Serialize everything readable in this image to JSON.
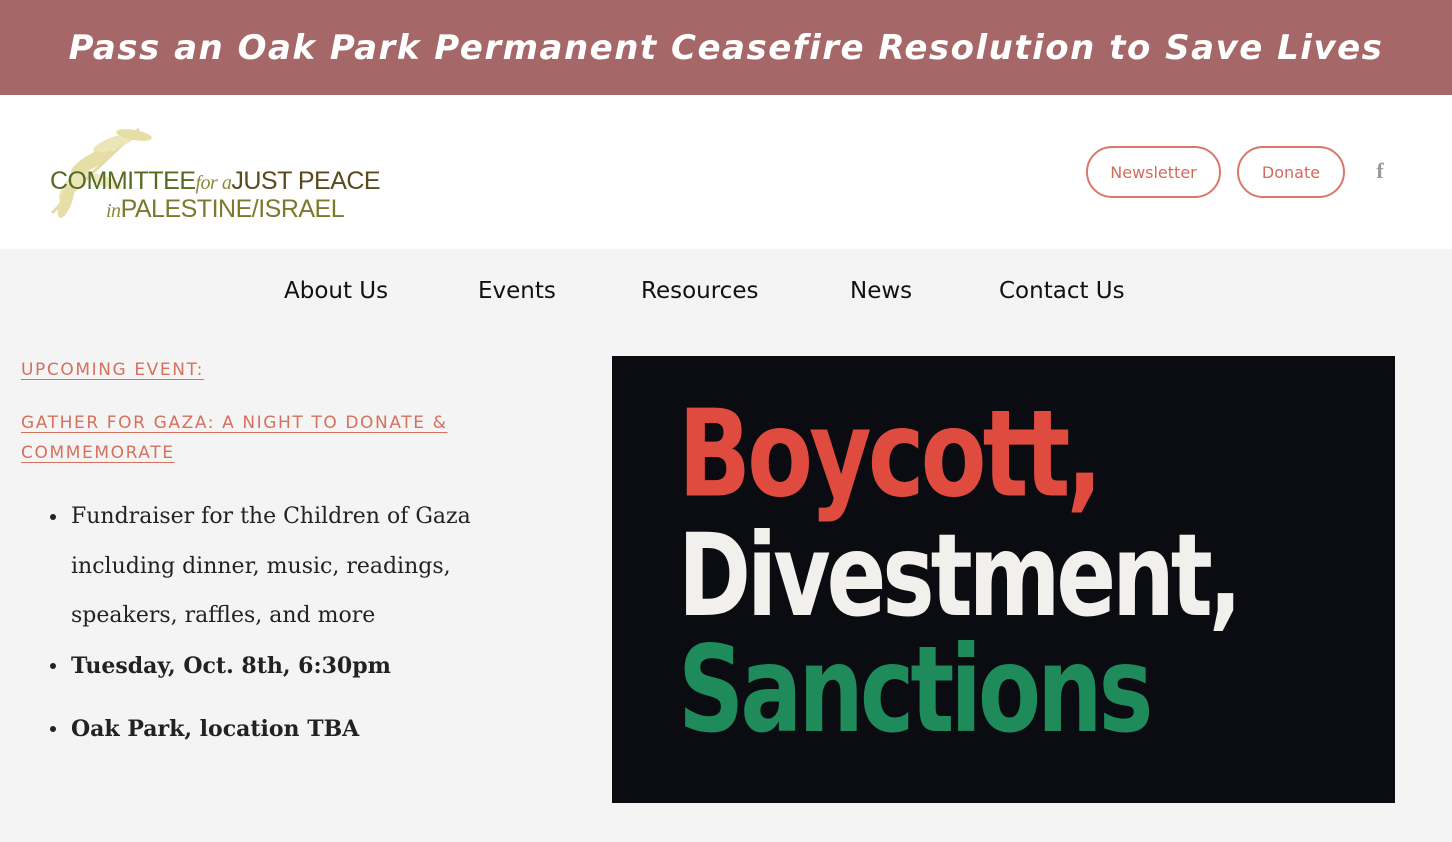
{
  "banner": {
    "text": "Pass an Oak Park Permanent Ceasefire Resolution to Save Lives"
  },
  "logo": {
    "line1_a": "COMMITTEE",
    "line1_b": "for a",
    "line1_c": "JUST PEACE",
    "line2_a": "in",
    "line2_b": "PALESTINE/ISRAEL"
  },
  "header": {
    "newsletter_label": "Newsletter",
    "donate_label": "Donate",
    "facebook_glyph": "f"
  },
  "nav": {
    "items": [
      {
        "label": "About Us"
      },
      {
        "label": "Events"
      },
      {
        "label": "Resources"
      },
      {
        "label": "News"
      },
      {
        "label": "Contact Us"
      }
    ]
  },
  "event": {
    "label": "UPCOMING EVENT:",
    "title": "GATHER FOR GAZA: A NIGHT TO DONATE & COMMEMORATE",
    "bullets": [
      "Fundraiser for the Children of Gaza including dinner, music, readings, speakers, raffles, and more",
      "Tuesday, Oct. 8th, 6:30pm",
      "Oak Park, location TBA"
    ]
  },
  "poster": {
    "line1": "Boycott,",
    "line2": "Divestment,",
    "line3": "Sanctions"
  },
  "colors": {
    "banner": "#a56767",
    "accent": "#d6705f",
    "poster_red": "#e04b3f",
    "poster_white": "#f2f0ec",
    "poster_green": "#1f8a5a"
  },
  "icons": [
    "olive-branch-icon",
    "facebook-icon"
  ]
}
